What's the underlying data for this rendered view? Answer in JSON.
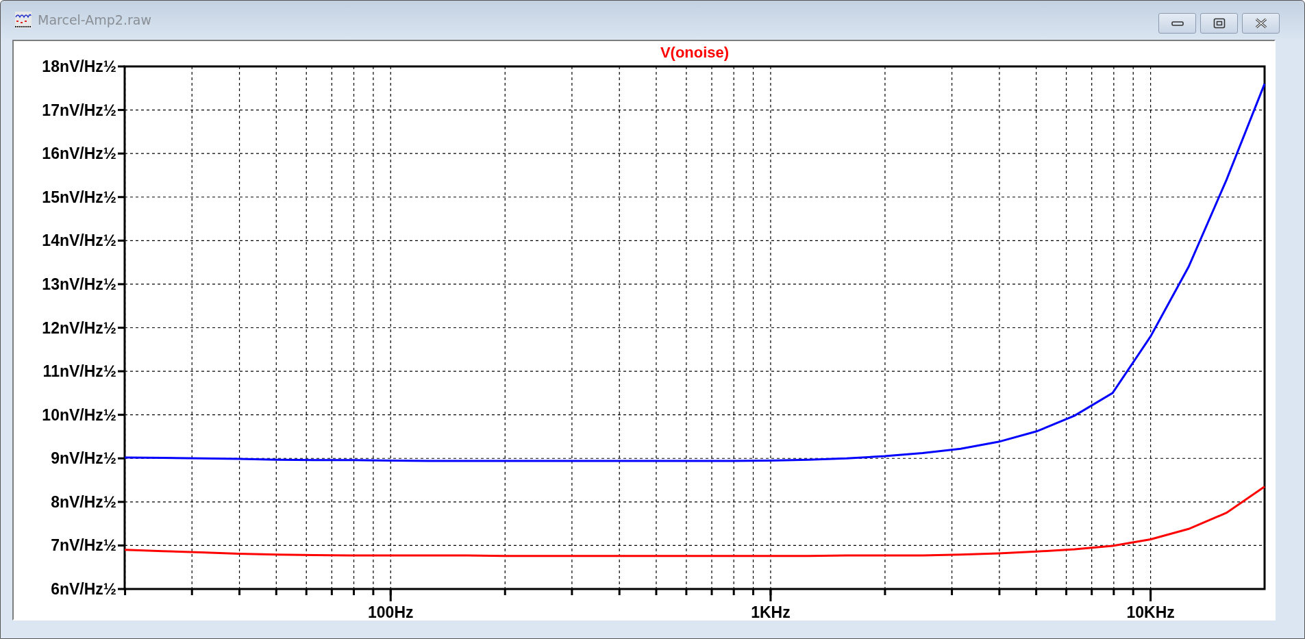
{
  "window": {
    "title": "Marcel-Amp2.raw"
  },
  "plot": {
    "chart_data": {
      "type": "line",
      "grid": true,
      "categories": [
        null,
        null,
        null,
        null,
        null,
        null,
        null,
        "100Hz",
        null,
        null,
        null,
        null,
        null,
        null,
        null,
        null,
        null,
        "1KHz",
        null,
        null,
        null,
        null,
        null,
        null,
        null,
        null,
        null,
        "10KHz",
        null,
        null,
        null
      ],
      "series": [
        {
          "color": "#0000ff",
          "values": [
            9.02,
            9.01,
            9.0,
            8.99,
            8.97,
            8.96,
            8.96,
            8.95,
            8.94,
            8.94,
            8.94,
            8.94,
            8.94,
            8.94,
            8.94,
            8.94,
            8.94,
            8.95,
            8.97,
            9.0,
            9.05,
            9.12,
            9.22,
            9.38,
            9.62,
            9.98,
            10.5,
            11.8,
            13.4,
            15.4,
            17.6
          ]
        },
        {
          "name": "V(onoise)",
          "color": "#ff0000",
          "values": [
            6.9,
            6.87,
            6.84,
            6.81,
            6.79,
            6.78,
            6.77,
            6.77,
            6.77,
            6.77,
            6.76,
            6.76,
            6.76,
            6.76,
            6.76,
            6.76,
            6.76,
            6.76,
            6.76,
            6.77,
            6.77,
            6.77,
            6.79,
            6.82,
            6.86,
            6.91,
            6.99,
            7.14,
            7.38,
            7.75,
            8.35
          ]
        }
      ],
      "ylim": [
        6,
        18
      ],
      "yticks": [
        {
          "value": 6,
          "label": "6nV/Hz½"
        },
        {
          "value": 7,
          "label": "7nV/Hz½"
        },
        {
          "value": 8,
          "label": "8nV/Hz½"
        },
        {
          "value": 9,
          "label": "9nV/Hz½"
        },
        {
          "value": 10,
          "label": "10nV/Hz½"
        },
        {
          "value": 11,
          "label": "11nV/Hz½"
        },
        {
          "value": 12,
          "label": "12nV/Hz½"
        },
        {
          "value": 13,
          "label": "13nV/Hz½"
        },
        {
          "value": 14,
          "label": "14nV/Hz½"
        },
        {
          "value": 15,
          "label": "15nV/Hz½"
        },
        {
          "value": 16,
          "label": "16nV/Hz½"
        },
        {
          "value": 17,
          "label": "17nV/Hz½"
        },
        {
          "value": 18,
          "label": "18nV/Hz½"
        }
      ]
    }
  }
}
